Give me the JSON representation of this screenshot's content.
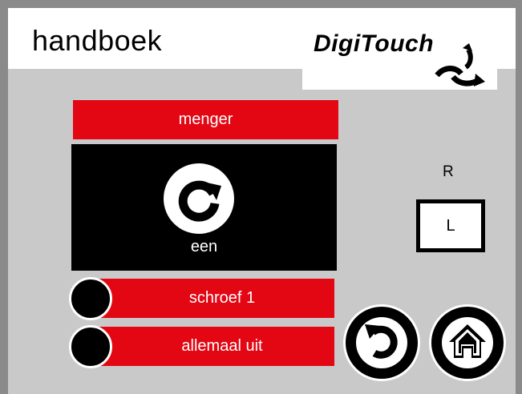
{
  "header": {
    "title": "handboek",
    "logo_text": "DigiTouch"
  },
  "mixer": {
    "label": "menger",
    "state_label": "een",
    "direction_top": "R",
    "direction_button": "L"
  },
  "buttons": {
    "screw_label": "schroef 1",
    "all_off_label": "allemaal uit"
  },
  "icons": {
    "rotate": "rotate-clockwise-icon",
    "back": "back-arrow-icon",
    "home": "home-icon",
    "logo_swoosh": "rotation-arrows-icon"
  },
  "colors": {
    "accent_red": "#e30613",
    "background": "#c9c9c9",
    "frame": "#8a8a8a"
  }
}
